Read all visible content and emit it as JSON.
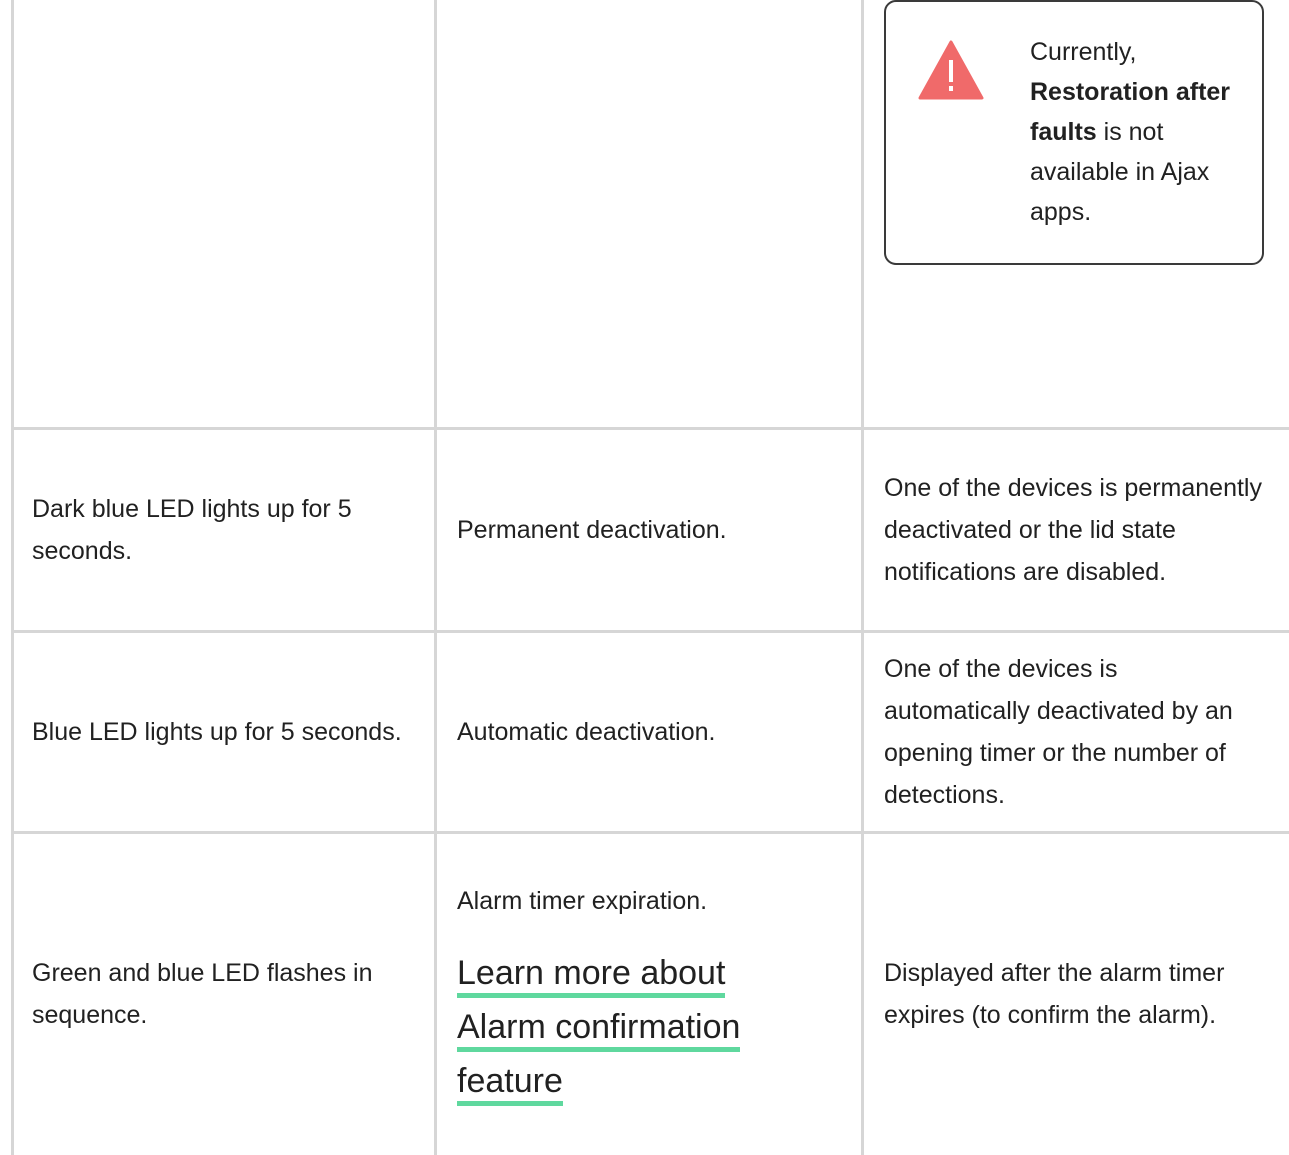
{
  "warning": {
    "prefix": "Currently,",
    "bold": "Restoration after faults",
    "suffix": "is not available in Ajax apps.",
    "icon": "warning-triangle-icon",
    "icon_color": "#f06a6a"
  },
  "rows": [
    {
      "indication": "Dark blue LED lights up for 5 seconds.",
      "event": "Permanent deactivation.",
      "note": "One of the devices is permanently deactivated or the lid state notifications are disabled."
    },
    {
      "indication": "Blue LED lights up for 5 seconds.",
      "event": "Automatic deactivation.",
      "note": "One of the devices is automatically deactivated by an opening timer or the number of detections."
    },
    {
      "indication": "Green and blue LED flashes in sequence.",
      "event": "Alarm timer expiration.",
      "link": [
        "Learn more about",
        "Alarm confirmation",
        "feature"
      ],
      "note": "Displayed after the alarm timer expires (to confirm the alarm)."
    }
  ],
  "colors": {
    "grid": "#d6d6d6",
    "link_underline": "#5fd89e",
    "text": "#212121"
  }
}
